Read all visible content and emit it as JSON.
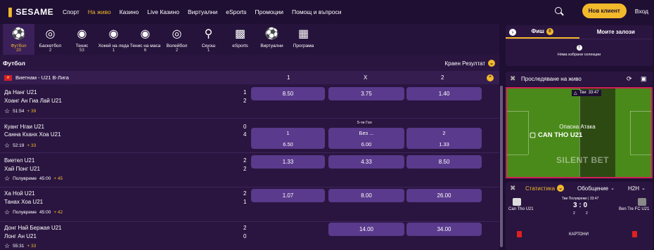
{
  "header": {
    "logo": "SESAME",
    "nav": [
      "Спорт",
      "На живо",
      "Казино",
      "Live Казино",
      "Виртуални",
      "eSports",
      "Промоции",
      "Помощ и въпроси"
    ],
    "active_nav": "На живо",
    "new_client": "Нов клиент",
    "login": "Вход"
  },
  "sports": [
    {
      "name": "Футбол",
      "count": "20",
      "icon": "football-icon"
    },
    {
      "name": "Баскетбол",
      "count": "2",
      "icon": "basketball-icon"
    },
    {
      "name": "Тенис",
      "count": "53",
      "icon": "tennis-icon"
    },
    {
      "name": "Хокей на леда",
      "count": "1",
      "icon": "hockey-icon"
    },
    {
      "name": "Тенис на маса",
      "count": "6",
      "icon": "table-tennis-icon"
    },
    {
      "name": "Волейбол",
      "count": "2",
      "icon": "volleyball-icon"
    },
    {
      "name": "Скуош",
      "count": "1",
      "icon": "squash-icon"
    },
    {
      "name": "eSports",
      "count": "",
      "icon": "gamepad-icon"
    },
    {
      "name": "Виртуални",
      "count": "",
      "icon": "virtual-football-icon"
    },
    {
      "name": "Програма",
      "count": "",
      "icon": "calendar-icon"
    }
  ],
  "section": {
    "title": "Футбол",
    "market": "Краен Резултат"
  },
  "league": {
    "name": "Виетнам - U21 В-Лига",
    "col1": "1",
    "colx": "X",
    "col2": "2"
  },
  "matches": [
    {
      "home": "Да Нанг U21",
      "away": "Хоанг Ан Гиа Лай U21",
      "hs": "1",
      "as": "2",
      "time": "51:54",
      "extra": "+ 39",
      "period": "",
      "o1": "8.50",
      "ox": "3.75",
      "o2": "1.40"
    },
    {
      "home": "Куанг Нгаи U21",
      "away": "Санна Кханх Хоа U21",
      "hs": "0",
      "as": "4",
      "time": "52:19",
      "extra": "+ 33",
      "period": "",
      "market": "5-ти Гол",
      "l1": "1",
      "lx": "Без ...",
      "l2": "2",
      "o1": "6.50",
      "ox": "6.00",
      "o2": "1.33"
    },
    {
      "home": "Виетел U21",
      "away": "Хай Понг U21",
      "hs": "2",
      "as": "2",
      "time": "45:00",
      "extra": "+ 45",
      "period": "Полувреме",
      "o1": "1.33",
      "ox": "4.33",
      "o2": "8.50"
    },
    {
      "home": "Ха Ной U21",
      "away": "Танах Хоа U21",
      "hs": "2",
      "as": "1",
      "time": "45:00",
      "extra": "+ 42",
      "period": "Полувреме",
      "o1": "1.07",
      "ox": "8.00",
      "o2": "26.00"
    },
    {
      "home": "Донг Най Бержая U21",
      "away": "Лонг Ан U21",
      "hs": "2",
      "as": "0",
      "time": "55:31",
      "extra": "+ 33",
      "period": "",
      "o1": "",
      "ox": "14.00",
      "o2": "34.00"
    }
  ],
  "slip": {
    "tab1": "Фиш",
    "count": "0",
    "tab2": "Моите залози",
    "empty": "Няма избрани селекции"
  },
  "live": {
    "title": "Проследяване на живо",
    "field_time": "33:47",
    "field_label": "Тви",
    "attack": "Опасна Атака",
    "team": "CAN THO U21",
    "watermark": "SILENT BET"
  },
  "stats": {
    "tab1": "Статистика",
    "tab2": "Обобщение",
    "tab3": "H2H",
    "period": "Тви Полувреме | 33:47",
    "home": "Can Tho U21",
    "away": "Ben Tre FC U21",
    "score": "3 : 0",
    "hs2": "2",
    "as2": "2",
    "cards": "КАРТОНИ"
  }
}
